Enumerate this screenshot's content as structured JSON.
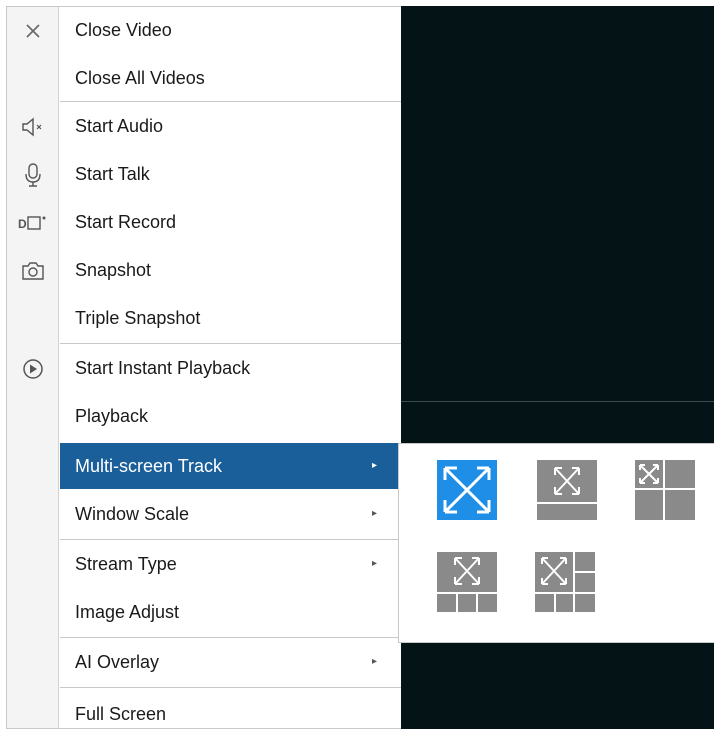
{
  "menu": {
    "items": [
      {
        "label": "Close Video",
        "icon": "close-icon"
      },
      {
        "label": "Close All Videos"
      },
      {
        "label": "Start Audio",
        "icon": "speaker-muted-icon"
      },
      {
        "label": "Start Talk",
        "icon": "microphone-icon"
      },
      {
        "label": "Start Record",
        "icon": "record-icon"
      },
      {
        "label": "Snapshot",
        "icon": "camera-icon"
      },
      {
        "label": "Triple Snapshot"
      },
      {
        "label": "Start Instant Playback",
        "icon": "play-circle-icon"
      },
      {
        "label": "Playback"
      },
      {
        "label": "Multi-screen Track",
        "submenu": true,
        "active": true
      },
      {
        "label": "Window Scale",
        "submenu": true
      },
      {
        "label": "Stream Type",
        "submenu": true
      },
      {
        "label": "Image Adjust"
      },
      {
        "label": "AI Overlay",
        "submenu": true
      },
      {
        "label": "Full Screen"
      }
    ],
    "arrow_glyph": "▸"
  },
  "submenu": {
    "layouts": [
      {
        "name": "fullscreen-single-layout",
        "selected": true
      },
      {
        "name": "main-plus-bottom-layout",
        "selected": false
      },
      {
        "name": "main-plus-grid-layout",
        "selected": false
      },
      {
        "name": "main-plus-bottom-three-layout",
        "selected": false
      },
      {
        "name": "main-plus-right-bottom-layout",
        "selected": false
      }
    ]
  },
  "colors": {
    "active_bg": "#1a5f9a",
    "selected_layout": "#1e8ee6",
    "layout_gray": "#8a8a8a",
    "video_bg": "#041416"
  }
}
